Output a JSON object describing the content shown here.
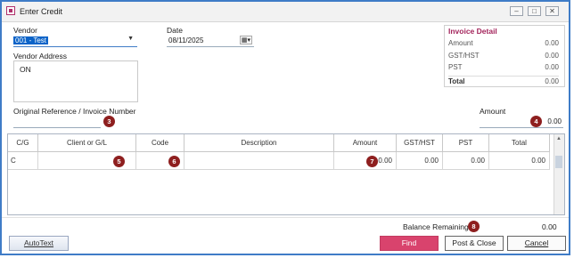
{
  "window": {
    "title": "Enter Credit"
  },
  "vendor": {
    "label": "Vendor",
    "value": "001 - Test"
  },
  "date": {
    "label": "Date",
    "value": "08/11/2025"
  },
  "vendor_address": {
    "label": "Vendor Address",
    "value": "ON"
  },
  "invoice_detail": {
    "title": "Invoice Detail",
    "rows": [
      {
        "label": "Amount",
        "value": "0.00"
      },
      {
        "label": "GST/HST",
        "value": "0.00"
      },
      {
        "label": "PST",
        "value": "0.00"
      },
      {
        "label": "Total",
        "value": "0.00"
      }
    ]
  },
  "reference": {
    "label": "Original Reference / Invoice Number",
    "value": ""
  },
  "amount": {
    "label": "Amount",
    "value": "0.00"
  },
  "grid": {
    "headers": [
      "C/G",
      "Client or G/L",
      "Code",
      "Description",
      "Amount",
      "GST/HST",
      "PST",
      "Total"
    ],
    "row": [
      "C",
      "",
      "",
      "",
      "0.00",
      "0.00",
      "0.00",
      "0.00"
    ]
  },
  "balance": {
    "label": "Balance Remaining",
    "value": "0.00"
  },
  "buttons": {
    "autotext": "AutoText",
    "find": "Find",
    "post_close": "Post & Close",
    "cancel": "Cancel"
  },
  "markers": [
    "3",
    "4",
    "5",
    "6",
    "7",
    "8"
  ],
  "colors": {
    "accent": "#a3245b",
    "find_button": "#d9436d",
    "marker": "#8e1f1f",
    "window_border": "#3f7cc7"
  }
}
